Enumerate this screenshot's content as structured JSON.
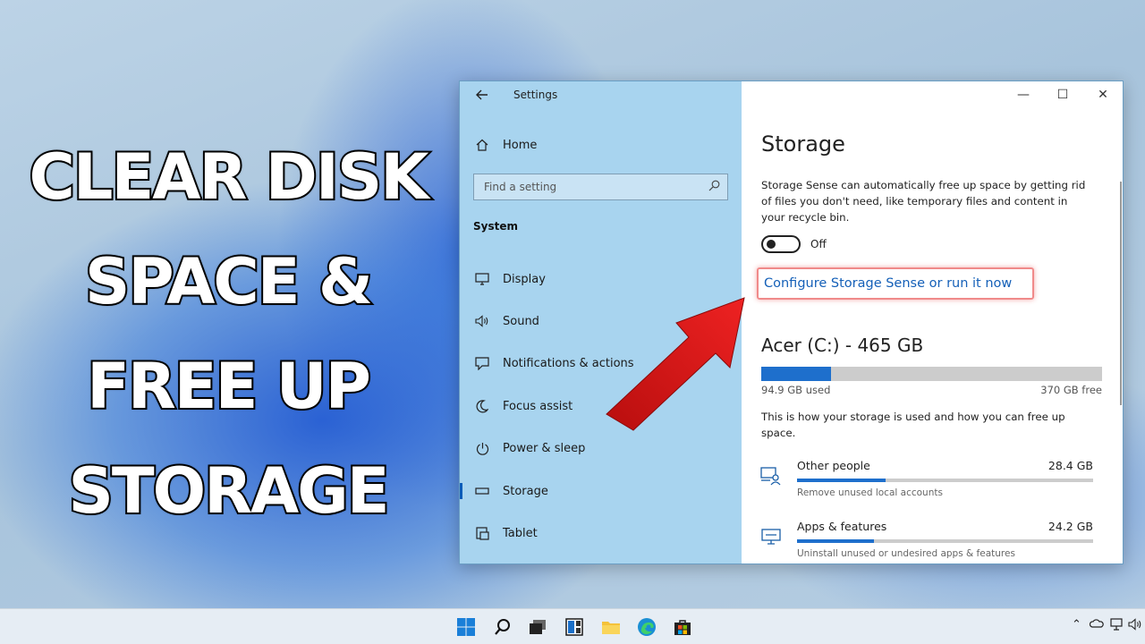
{
  "headline": [
    "CLEAR DISK",
    "SPACE &",
    "FREE UP",
    "STORAGE"
  ],
  "window": {
    "title": "Settings",
    "back_icon": "back-arrow-icon",
    "controls": {
      "minimize": "—",
      "maximize": "☐",
      "close": "✕"
    }
  },
  "sidebar": {
    "home_label": "Home",
    "search_placeholder": "Find a setting",
    "section_label": "System",
    "items": [
      {
        "label": "Display",
        "icon": "display-icon"
      },
      {
        "label": "Sound",
        "icon": "sound-icon"
      },
      {
        "label": "Notifications & actions",
        "icon": "notifications-icon"
      },
      {
        "label": "Focus assist",
        "icon": "focus-assist-icon"
      },
      {
        "label": "Power & sleep",
        "icon": "power-icon"
      },
      {
        "label": "Storage",
        "icon": "storage-icon",
        "active": true
      },
      {
        "label": "Tablet",
        "icon": "tablet-icon"
      }
    ]
  },
  "content": {
    "title": "Storage",
    "description": "Storage Sense can automatically free up space by getting rid of files you don't need, like temporary files and content in your recycle bin.",
    "toggle_state": "Off",
    "config_link": "Configure Storage Sense or run it now",
    "drive": {
      "title": "Acer (C:) - 465 GB",
      "used_label": "94.9 GB used",
      "free_label": "370 GB free",
      "used_fraction": 0.204
    },
    "usage_description": "This is how your storage is used and how you can free up space.",
    "categories": [
      {
        "name": "Other people",
        "size": "28.4 GB",
        "hint": "Remove unused local accounts",
        "fraction": 0.3,
        "icon": "other-people-icon"
      },
      {
        "name": "Apps & features",
        "size": "24.2 GB",
        "hint": "Uninstall unused or undesired apps & features",
        "fraction": 0.26,
        "icon": "apps-features-icon"
      }
    ]
  },
  "colors": {
    "accent": "#1e6fcc",
    "sidebar_bg": "#a8d4ef",
    "arrow": "#e01b1b",
    "link": "#1560b8"
  },
  "taskbar": {
    "icons": [
      "start-icon",
      "search-icon",
      "task-view-icon",
      "widgets-icon",
      "file-explorer-icon",
      "edge-icon",
      "store-icon"
    ]
  }
}
